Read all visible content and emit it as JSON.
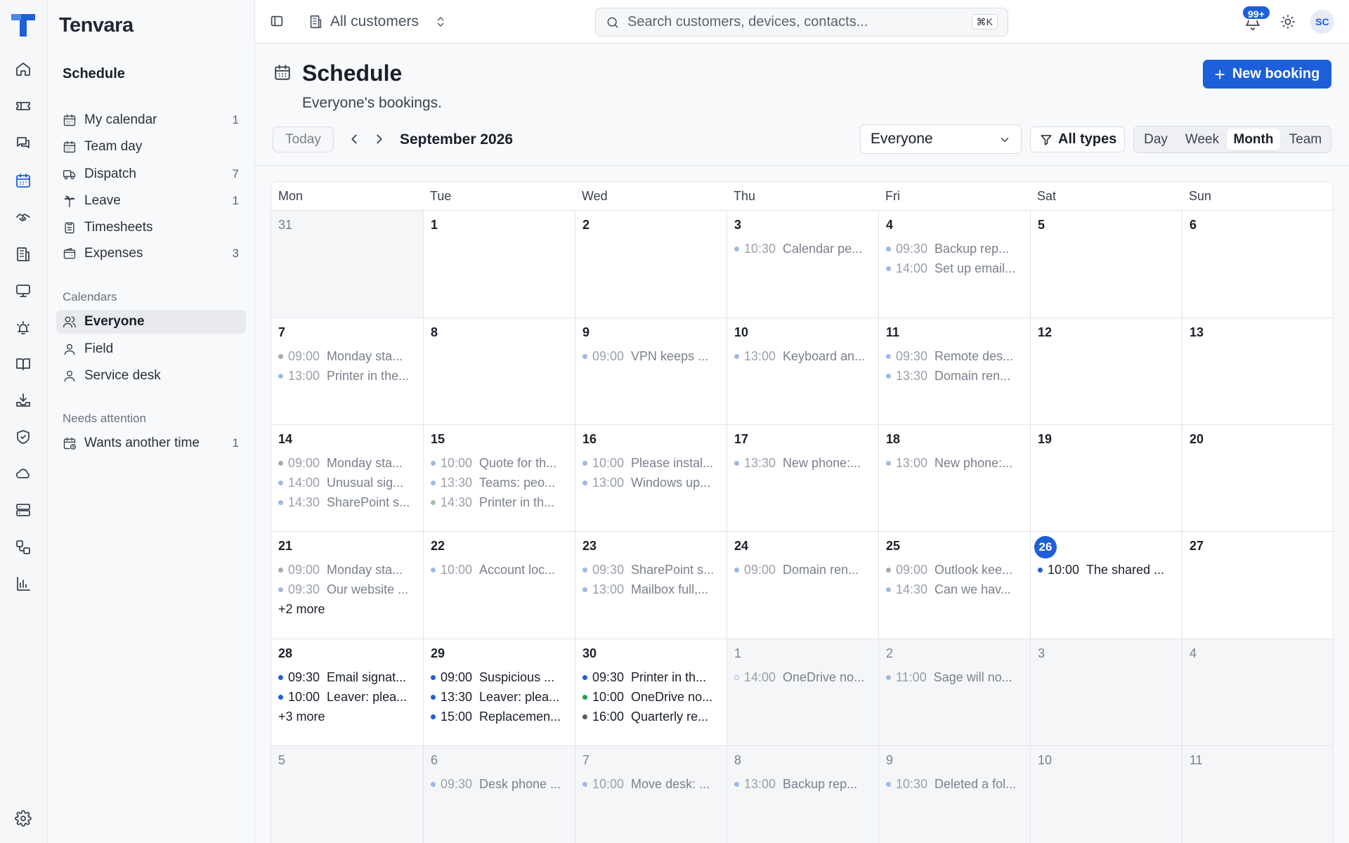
{
  "app": {
    "name": "Tenvara"
  },
  "rail": {
    "items": [
      {
        "icon": "home-icon"
      },
      {
        "icon": "ticket-icon"
      },
      {
        "icon": "chat-icon"
      },
      {
        "icon": "calendar-icon",
        "active": true
      },
      {
        "icon": "handshake-icon"
      },
      {
        "icon": "building-icon"
      },
      {
        "icon": "monitor-icon"
      },
      {
        "icon": "alarm-icon"
      },
      {
        "icon": "book-icon"
      },
      {
        "icon": "download-tray-icon"
      },
      {
        "icon": "shield-icon"
      },
      {
        "icon": "cloud-icon"
      },
      {
        "icon": "server-icon"
      },
      {
        "icon": "workflow-icon"
      },
      {
        "icon": "bar-chart-icon"
      }
    ],
    "settings_icon": "gear-icon"
  },
  "sidebar": {
    "title": "Schedule",
    "items": [
      {
        "label": "My calendar",
        "count": "1",
        "icon": "calendar-icon"
      },
      {
        "label": "Team day",
        "count": "",
        "icon": "calendar-icon"
      },
      {
        "label": "Dispatch",
        "count": "7",
        "icon": "truck-icon"
      },
      {
        "label": "Leave",
        "count": "1",
        "icon": "palm-tree-icon"
      },
      {
        "label": "Timesheets",
        "count": "",
        "icon": "clipboard-icon"
      },
      {
        "label": "Expenses",
        "count": "3",
        "icon": "wallet-icon"
      }
    ],
    "calendars_heading": "Calendars",
    "calendars": [
      {
        "label": "Everyone",
        "icon": "users-icon",
        "selected": true
      },
      {
        "label": "Field",
        "icon": "user-icon"
      },
      {
        "label": "Service desk",
        "icon": "user-icon"
      }
    ],
    "attention_heading": "Needs attention",
    "attention": [
      {
        "label": "Wants another time",
        "count": "1",
        "icon": "calendar-clock-icon"
      }
    ]
  },
  "topbar": {
    "customer_selector": "All customers",
    "search_placeholder": "Search customers, devices, contacts...",
    "search_shortcut": "⌘K",
    "notifications_badge": "99+",
    "avatar_initials": "SC"
  },
  "page": {
    "title": "Schedule",
    "subtitle": "Everyone's bookings.",
    "new_booking_label": "New booking"
  },
  "toolbar": {
    "today_label": "Today",
    "month_label": "September 2026",
    "people_filter": "Everyone",
    "types_filter": "All types",
    "views": [
      "Day",
      "Week",
      "Month",
      "Team"
    ],
    "active_view": "Month"
  },
  "colors": {
    "accent": "#1d5fd8",
    "dot_pale_blue": "#9fb8e8",
    "dot_grey": "#a6abb4",
    "dot_pale_green": "#9dc8a8",
    "dot_blue": "#1d5fd8",
    "dot_green": "#1f9d55",
    "dot_dark_grey": "#545b66"
  },
  "calendar": {
    "weekdays": [
      "Mon",
      "Tue",
      "Wed",
      "Thu",
      "Fri",
      "Sat",
      "Sun"
    ],
    "weeks": [
      [
        {
          "day": "31",
          "out": true,
          "events": []
        },
        {
          "day": "1",
          "events": []
        },
        {
          "day": "2",
          "events": []
        },
        {
          "day": "3",
          "events": [
            {
              "time": "10:30",
              "title": "Calendar pe...",
              "dot": "dot_pale_blue"
            }
          ]
        },
        {
          "day": "4",
          "events": [
            {
              "time": "09:30",
              "title": "Backup rep...",
              "dot": "dot_pale_blue"
            },
            {
              "time": "14:00",
              "title": "Set up email...",
              "dot": "dot_pale_blue"
            }
          ]
        },
        {
          "day": "5",
          "events": []
        },
        {
          "day": "6",
          "events": []
        }
      ],
      [
        {
          "day": "7",
          "events": [
            {
              "time": "09:00",
              "title": "Monday sta...",
              "dot": "dot_grey"
            },
            {
              "time": "13:00",
              "title": "Printer in the...",
              "dot": "dot_pale_blue"
            }
          ]
        },
        {
          "day": "8",
          "events": []
        },
        {
          "day": "9",
          "events": [
            {
              "time": "09:00",
              "title": "VPN keeps ...",
              "dot": "dot_pale_blue"
            }
          ]
        },
        {
          "day": "10",
          "events": [
            {
              "time": "13:00",
              "title": "Keyboard an...",
              "dot": "dot_pale_blue"
            }
          ]
        },
        {
          "day": "11",
          "events": [
            {
              "time": "09:30",
              "title": "Remote des...",
              "dot": "dot_pale_blue"
            },
            {
              "time": "13:30",
              "title": "Domain ren...",
              "dot": "dot_pale_blue"
            }
          ]
        },
        {
          "day": "12",
          "events": []
        },
        {
          "day": "13",
          "events": []
        }
      ],
      [
        {
          "day": "14",
          "events": [
            {
              "time": "09:00",
              "title": "Monday sta...",
              "dot": "dot_grey"
            },
            {
              "time": "14:00",
              "title": "Unusual sig...",
              "dot": "dot_pale_blue"
            },
            {
              "time": "14:30",
              "title": "SharePoint s...",
              "dot": "dot_pale_blue"
            }
          ]
        },
        {
          "day": "15",
          "events": [
            {
              "time": "10:00",
              "title": "Quote for th...",
              "dot": "dot_pale_blue"
            },
            {
              "time": "13:30",
              "title": "Teams: peo...",
              "dot": "dot_pale_blue"
            },
            {
              "time": "14:30",
              "title": "Printer in th...",
              "dot": "dot_pale_green"
            }
          ]
        },
        {
          "day": "16",
          "events": [
            {
              "time": "10:00",
              "title": "Please instal...",
              "dot": "dot_pale_blue"
            },
            {
              "time": "13:00",
              "title": "Windows up...",
              "dot": "dot_pale_blue"
            }
          ]
        },
        {
          "day": "17",
          "events": [
            {
              "time": "13:30",
              "title": "New phone:...",
              "dot": "dot_pale_blue"
            }
          ]
        },
        {
          "day": "18",
          "events": [
            {
              "time": "13:00",
              "title": "New phone:...",
              "dot": "dot_pale_blue"
            }
          ]
        },
        {
          "day": "19",
          "events": []
        },
        {
          "day": "20",
          "events": []
        }
      ],
      [
        {
          "day": "21",
          "events": [
            {
              "time": "09:00",
              "title": "Monday sta...",
              "dot": "dot_grey"
            },
            {
              "time": "09:30",
              "title": "Our website ...",
              "dot": "dot_pale_blue"
            }
          ],
          "more": "+2 more"
        },
        {
          "day": "22",
          "events": [
            {
              "time": "10:00",
              "title": "Account loc...",
              "dot": "dot_pale_blue"
            }
          ]
        },
        {
          "day": "23",
          "events": [
            {
              "time": "09:30",
              "title": "SharePoint s...",
              "dot": "dot_pale_blue"
            },
            {
              "time": "13:00",
              "title": "Mailbox full,...",
              "dot": "dot_pale_blue"
            }
          ]
        },
        {
          "day": "24",
          "events": [
            {
              "time": "09:00",
              "title": "Domain ren...",
              "dot": "dot_pale_blue"
            }
          ]
        },
        {
          "day": "25",
          "events": [
            {
              "time": "09:00",
              "title": "Outlook kee...",
              "dot": "dot_grey"
            },
            {
              "time": "14:30",
              "title": "Can we hav...",
              "dot": "dot_pale_blue"
            }
          ]
        },
        {
          "day": "26",
          "today": true,
          "events": [
            {
              "time": "10:00",
              "title": "The shared ...",
              "dot": "dot_blue",
              "strong": true
            }
          ]
        },
        {
          "day": "27",
          "events": []
        }
      ],
      [
        {
          "day": "28",
          "events": [
            {
              "time": "09:30",
              "title": "Email signat...",
              "dot": "dot_blue",
              "strong": true
            },
            {
              "time": "10:00",
              "title": "Leaver: plea...",
              "dot": "dot_blue",
              "strong": true
            }
          ],
          "more": "+3 more"
        },
        {
          "day": "29",
          "events": [
            {
              "time": "09:00",
              "title": "Suspicious ...",
              "dot": "dot_blue",
              "strong": true
            },
            {
              "time": "13:30",
              "title": "Leaver: plea...",
              "dot": "dot_blue",
              "strong": true
            },
            {
              "time": "15:00",
              "title": "Replacemen...",
              "dot": "dot_blue",
              "strong": true
            }
          ]
        },
        {
          "day": "30",
          "events": [
            {
              "time": "09:30",
              "title": "Printer in th...",
              "dot": "dot_blue",
              "strong": true
            },
            {
              "time": "10:00",
              "title": "OneDrive no...",
              "dot": "dot_green",
              "strong": true
            },
            {
              "time": "16:00",
              "title": "Quarterly re...",
              "dot": "dot_dark_grey",
              "strong": true
            }
          ]
        },
        {
          "day": "1",
          "out": true,
          "events": [
            {
              "time": "14:00",
              "title": "OneDrive no...",
              "dot": "dot_pale_blue",
              "ring": true
            }
          ]
        },
        {
          "day": "2",
          "out": true,
          "events": [
            {
              "time": "11:00",
              "title": "Sage will no...",
              "dot": "dot_pale_blue"
            }
          ]
        },
        {
          "day": "3",
          "out": true,
          "events": []
        },
        {
          "day": "4",
          "out": true,
          "events": []
        }
      ],
      [
        {
          "day": "5",
          "out": true,
          "events": []
        },
        {
          "day": "6",
          "out": true,
          "events": [
            {
              "time": "09:30",
              "title": "Desk phone ...",
              "dot": "dot_pale_blue"
            }
          ]
        },
        {
          "day": "7",
          "out": true,
          "events": [
            {
              "time": "10:00",
              "title": "Move desk: ...",
              "dot": "dot_pale_blue"
            }
          ]
        },
        {
          "day": "8",
          "out": true,
          "events": [
            {
              "time": "13:00",
              "title": "Backup rep...",
              "dot": "dot_pale_blue"
            }
          ]
        },
        {
          "day": "9",
          "out": true,
          "events": [
            {
              "time": "10:30",
              "title": "Deleted a fol...",
              "dot": "dot_pale_blue"
            }
          ]
        },
        {
          "day": "10",
          "out": true,
          "events": []
        },
        {
          "day": "11",
          "out": true,
          "events": []
        }
      ]
    ]
  }
}
